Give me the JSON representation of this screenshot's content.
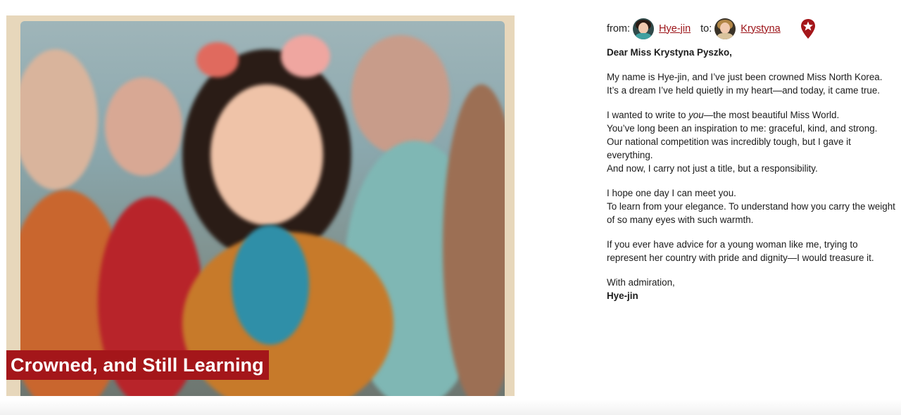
{
  "photo": {
    "caption": "Crowned, and Still Learning"
  },
  "letter": {
    "from_label": "from:",
    "from_name": "Hye-jin",
    "to_label": "to:",
    "to_name": "Krystyna",
    "greeting": "Dear Miss Krystyna Pyszko,",
    "p1": [
      "My name is Hye-jin, and I’ve just been crowned Miss North Korea.",
      "It’s a dream I’ve held quietly in my heart—and today, it came true."
    ],
    "p2_line1_before": "I wanted to write to ",
    "p2_line1_em": "you",
    "p2_line1_after": "—the most beautiful Miss World.",
    "p2": [
      "You’ve long been an inspiration to me: graceful, kind, and strong.",
      "Our national competition was incredibly tough, but I gave it everything.",
      "And now, I carry not just a title, but a responsibility."
    ],
    "p3": [
      "I hope one day I can meet you.",
      "To learn from your elegance. To understand how you carry the weight of so many eyes with such warmth."
    ],
    "p4": [
      "If you ever have advice for a young woman like me, trying to represent her country with pride and dignity—I would treasure it."
    ],
    "closing": "With admiration,",
    "signature": "Hye-jin"
  },
  "colors": {
    "accent": "#a4161a",
    "link": "#9b1116"
  },
  "icons": {
    "location": "map-pin-star-icon"
  }
}
